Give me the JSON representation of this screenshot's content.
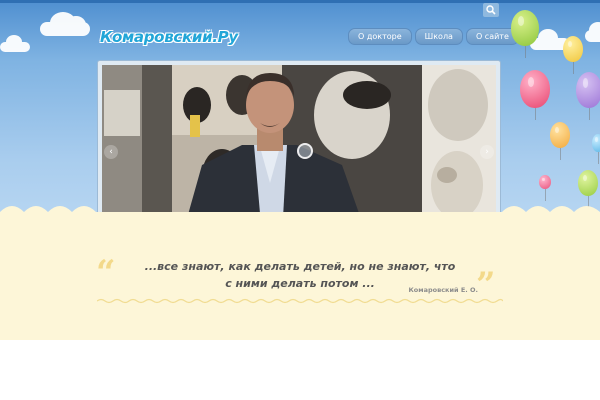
{
  "header": {
    "logo_text": "Комаровский.Ру",
    "search_icon": "magnifier-icon",
    "nav": [
      {
        "label": "О докторе"
      },
      {
        "label": "Школа"
      },
      {
        "label": "О сайте"
      }
    ]
  },
  "slider": {
    "prev_icon": "chevron-left-icon",
    "next_icon": "chevron-right-icon",
    "prev_glyph": "‹",
    "next_glyph": "›"
  },
  "quote": {
    "open_mark": "“",
    "close_mark": "”",
    "text": "...все знают, как делать детей, но не знают, что с ними делать потом ...",
    "author": "Комаровский Е. О."
  },
  "colors": {
    "sky_top": "#4f8fd0",
    "sky_bottom": "#bcd9f3",
    "logo": "#22a6d8",
    "cream": "#fdf6d8",
    "quote_marks": "#f3d98a",
    "quote_text": "#555555"
  }
}
